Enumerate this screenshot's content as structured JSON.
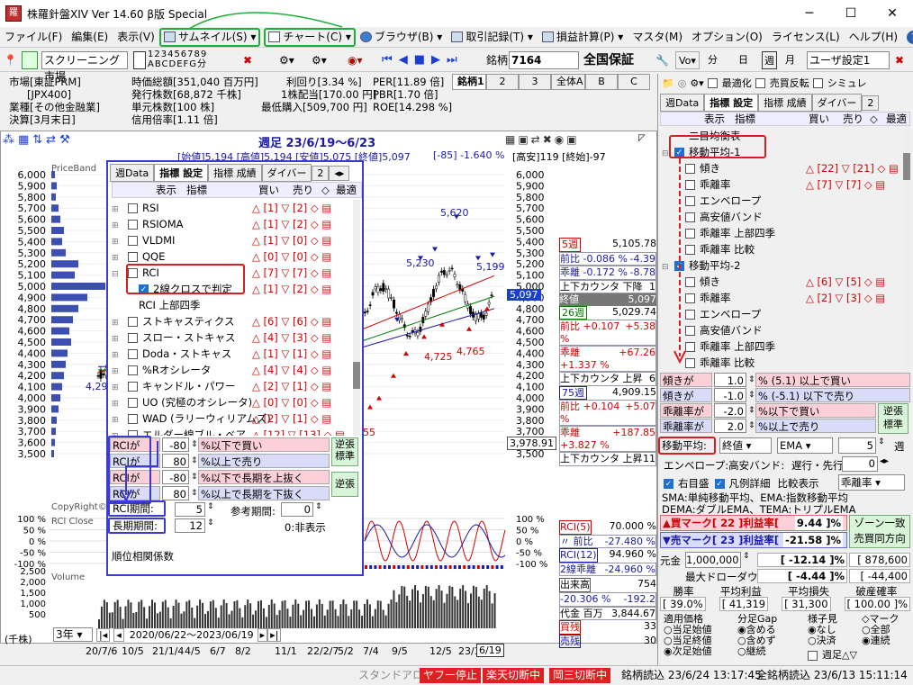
{
  "title": "株羅針盤XIV Ver 14.60 β版 Special",
  "menu": [
    "ファイル(F)",
    "編集(E)",
    "表示(V)",
    "サムネイル(S)",
    "チャート(C)",
    "ブラウザ(B)",
    "取引記録(T)",
    "損益計算(P)",
    "マスタ(M)",
    "オプション(O)",
    "ライセンス(L)",
    "ヘルプ(H)"
  ],
  "toolbar": {
    "screening": "スクリーニング市場",
    "digits": "123456789",
    "letters": "ABCDEFG分",
    "stock_label": "銘柄",
    "stock_code": "7164",
    "company": "全国保証",
    "vo": "Vo",
    "fen": "分",
    "day": "日",
    "week": "週",
    "month": "月",
    "user_setting": "ユーザ設定1"
  },
  "info": {
    "market": "市場[東証PRM]",
    "index": "[JPX400]",
    "industry": "業種[その他金融業]",
    "settle": "決算[3月末日]",
    "cap": "時価総額[351,040 百万円]",
    "shares": "発行株数[68,872 千株]",
    "unit": "単元株数[100 株]",
    "margin": "信用倍率[1.11 倍]",
    "yield": "利回り[3.34 %]",
    "dividend": "1株配当[170.00 円]",
    "minbuy": "最低購入[509,700 円]",
    "per": "PER[11.89 倍]",
    "pbr": "PBR[1.70 倍]",
    "roe": "ROE[14.298 %]"
  },
  "brand_tabs": [
    "銘柄1",
    "2",
    "3",
    "全体A",
    "B",
    "C"
  ],
  "chart": {
    "period": "週足 23/6/19～6/23",
    "ohlc": "[始値]5,194 [高値]5,194 [安値]5,075 [終値]5,097",
    "chg": "[-85] -1.640 %",
    "hilo": "[高安]119 [終始]-97",
    "axis": [
      "6,000",
      "5,900",
      "5,800",
      "5,700",
      "5,600",
      "5,500",
      "5,400",
      "5,300",
      "5,200",
      "5,100",
      "5,000",
      "4,900",
      "4,800",
      "4,700",
      "4,600",
      "4,500",
      "4,400",
      "4,300",
      "4,200",
      "4,100",
      "4,000",
      "3,900",
      "3,800",
      "3,700",
      "3,600",
      "3,500"
    ],
    "annot": [
      "5,620",
      "5,230",
      "5,199",
      "4,725",
      "4,765",
      "4,29",
      "55",
      "5,097",
      "3,978.91",
      "PriceBand",
      "CopyRight©",
      "RCI Close",
      "Volume"
    ],
    "osc": [
      "100 %",
      "50 %",
      "0 %",
      "-50 %",
      "-100 %"
    ],
    "vol": [
      "2,500",
      "2,000",
      "1,500",
      "1,000",
      "500"
    ],
    "unit": "(千株)",
    "range": "3年",
    "daterange": "2020/06/22～2023/06/19",
    "xdates": [
      "20/7/6",
      "10/5",
      "21/1/4",
      "4/5",
      "6/7",
      "8/2",
      "11/1",
      "22/2/7",
      "5/2",
      "7/4",
      "9/5",
      "12/5",
      "23/3/6",
      "6/19"
    ]
  },
  "ma_info": [
    {
      "k": "5週",
      "v": "5,105.78",
      "a": "前比 -0.086 %",
      "av": "-4.39",
      "b": "乖離 -0.172 %",
      "bv": "-8.78",
      "c": "上下カウンタ  下降",
      "cv": "1",
      "d": "終値",
      "dv": "5,097"
    },
    {
      "k": "26週",
      "v": "5,029.74",
      "a": "前比 +0.107 %",
      "av": "+5.38",
      "b": "乖離 +1.337 %",
      "bv": "+67.26",
      "c": "上下カウンタ  上昇",
      "cv": "6"
    },
    {
      "k": "75週",
      "v": "4,909.15",
      "a": "前比 +0.104 %",
      "av": "+5.07",
      "b": "乖離 +3.827 %",
      "bv": "+187.85",
      "c": "上下カウンタ  上昇",
      "cv": "11"
    }
  ],
  "rci_info": {
    "rci5": "RCI(5)",
    "rci5v": "70.000 %",
    "r1": "〃 前比",
    "r1v": "-27.480 %",
    "rci12": "RCI(12)",
    "rci12v": "94.960 %",
    "r2": "2線乖離",
    "r2v": "-24.960 %",
    "vol": "出来高",
    "volv": "754",
    "vol2": "-20.306 %",
    "vol2v": "-192.2",
    "money": "代金 百万",
    "moneyv": "3,844.67",
    "buy": "買残",
    "buyv": "33",
    "sell": "売残",
    "sellv": "30"
  },
  "popup": {
    "tabs": [
      "週Data",
      "指標",
      "設定",
      "指標",
      "成績",
      "ダイバー",
      "2"
    ],
    "head": [
      "表示",
      "指標",
      "買い",
      "売り",
      "◇",
      "最適"
    ],
    "items": [
      {
        "n": "RSI",
        "b": "[1]",
        "s": "[2]"
      },
      {
        "n": "RSIOMA",
        "b": "[1]",
        "s": "[2]"
      },
      {
        "n": "VLDMI",
        "b": "[1]",
        "s": "[0]"
      },
      {
        "n": "QQE",
        "b": "[0]",
        "s": "[0]"
      },
      {
        "n": "RCI",
        "b": "[7]",
        "s": "[7]"
      },
      {
        "n": "2線クロスで判定",
        "b": "[1]",
        "s": "[2]"
      },
      {
        "n": "RCI 上部四季",
        "b": "",
        "s": ""
      },
      {
        "n": "ストキャスティクス",
        "b": "[6]",
        "s": "[6]"
      },
      {
        "n": "スロー・ストキャス",
        "b": "[4]",
        "s": "[3]"
      },
      {
        "n": "Doda・ストキャス",
        "b": "[1]",
        "s": "[1]"
      },
      {
        "n": "%Rオシレータ",
        "b": "[4]",
        "s": "[4]"
      },
      {
        "n": "キャンドル・パワー",
        "b": "[2]",
        "s": "[1]"
      },
      {
        "n": "UO (究極のオシレータ)",
        "b": "[0]",
        "s": "[0]"
      },
      {
        "n": "WAD (ラリーウィリアムズ)",
        "b": "[2]",
        "s": "[1]"
      },
      {
        "n": "エルダー線ブル・ベア",
        "b": "[12]",
        "s": "[13]"
      }
    ],
    "cond": [
      {
        "l": "RCIが",
        "v": "-80",
        "t": "%以下で買い"
      },
      {
        "l": "RCIが",
        "v": "80",
        "t": "%以上で売り"
      },
      {
        "l": "RCIが",
        "v": "-80",
        "t": "%以下で長期を上抜く"
      },
      {
        "l": "RCIが",
        "v": "80",
        "t": "%以上で長期を下抜く"
      }
    ],
    "rev1": "逆張\n標準",
    "rev2": "逆張",
    "period_l": "RCI期間:",
    "period_v": "5",
    "long_l": "長期期間:",
    "long_v": "12",
    "ref_l": "参考期間:",
    "ref_v": "0",
    "ref_note": "0:非表示",
    "desc": "順位相関係数"
  },
  "right": {
    "checks": [
      "最適化",
      "売買反転",
      "シミュレ"
    ],
    "tabs": [
      "週Data",
      "指標",
      "設定",
      "指標",
      "成績",
      "ダイバー",
      "2"
    ],
    "head": [
      "表示",
      "指標",
      "買い",
      "売り",
      "◇",
      "最適"
    ],
    "top": "二目均衡表",
    "ma1": "移動平均-1",
    "items1": [
      {
        "n": "傾き",
        "b": "[22]",
        "s": "[21]"
      },
      {
        "n": "乖離率",
        "b": "[7]",
        "s": "[7]"
      },
      {
        "n": "エンベロープ",
        "b": "",
        "s": ""
      },
      {
        "n": "高安値バンド",
        "b": "",
        "s": ""
      },
      {
        "n": "乖離率 上部四季",
        "b": "",
        "s": ""
      },
      {
        "n": "乖離率 比較",
        "b": "",
        "s": ""
      }
    ],
    "ma2": "移動平均-2",
    "items2": [
      {
        "n": "傾き",
        "b": "[6]",
        "s": "[5]"
      },
      {
        "n": "乖離率",
        "b": "[2]",
        "s": "[3]"
      },
      {
        "n": "エンベロープ",
        "b": "",
        "s": ""
      },
      {
        "n": "高安値バンド",
        "b": "",
        "s": ""
      },
      {
        "n": "乖離率 上部四季",
        "b": "",
        "s": ""
      },
      {
        "n": "乖離率 比較",
        "b": "",
        "s": ""
      }
    ],
    "cond": [
      {
        "l": "傾きが",
        "v": "1.0",
        "t": "%  (5.1) 以上で買い"
      },
      {
        "l": "傾きが",
        "v": "-1.0",
        "t": "%  (-5.1) 以下で売り"
      },
      {
        "l": "乖離率が",
        "v": "-2.0",
        "t": "%以下で買い"
      },
      {
        "l": "乖離率が",
        "v": "2.0",
        "t": "%以上で売り"
      }
    ],
    "rev": "逆張\n標準",
    "ma_l": "移動平均:",
    "ma_v": "終値",
    "ma_t": "EMA",
    "ma_n": "5",
    "ma_u": "週",
    "env": "エンベロープ:高安バンド:",
    "lag": "遅行・先行",
    "lag_v": "0",
    "rt": "右目盛",
    "legend": "凡例詳細",
    "cmp": "比較表示",
    "cmp_v": "乖離率",
    "sma": "SMA:単純移動平均、EMA:指数移動平均",
    "dema": "DEMA:ダブルEMA、TEMA:トリプルEMA",
    "buy": "▲買マーク[ 22 ]利益率[",
    "buyv": "9.44",
    "sell": "▼売マーク[ 23 ]利益率[",
    "sellv": "-21.58",
    "zone": "ゾーン一致\n売買同方向",
    "yen_l": "元金",
    "yen_v": "1,000,000",
    "r1": "-12.14",
    "r1b": "878,600",
    "dd": "最大ドローダウン",
    "r2": "-4.44",
    "r2b": "-44,400",
    "stat_h": [
      "勝率",
      "平均利益",
      "平均損失",
      "破産確率"
    ],
    "stat_v": [
      "39.0",
      "41,319",
      "31,300",
      "100.00"
    ],
    "price_h": "適用価格",
    "price": [
      "当足始値",
      "当足終値",
      "次足始値"
    ],
    "gap_h": "分足Gap",
    "gap": [
      "含める",
      "含めず",
      "継続"
    ],
    "look_h": "様子見",
    "look": [
      "なし",
      "決済"
    ],
    "mark_h": "◇マーク",
    "mark": [
      "全部",
      "連続"
    ],
    "wk": "週足△▽"
  },
  "status": {
    "standalone": "スタンドアロン",
    "y1": "ヤフー停止",
    "y2": "楽天切断中",
    "y3": "岡三切断中",
    "s1": "銘柄読込 23/6/24 13:17:45",
    "s2": "全銘柄読込 23/6/13 15:11:14"
  }
}
